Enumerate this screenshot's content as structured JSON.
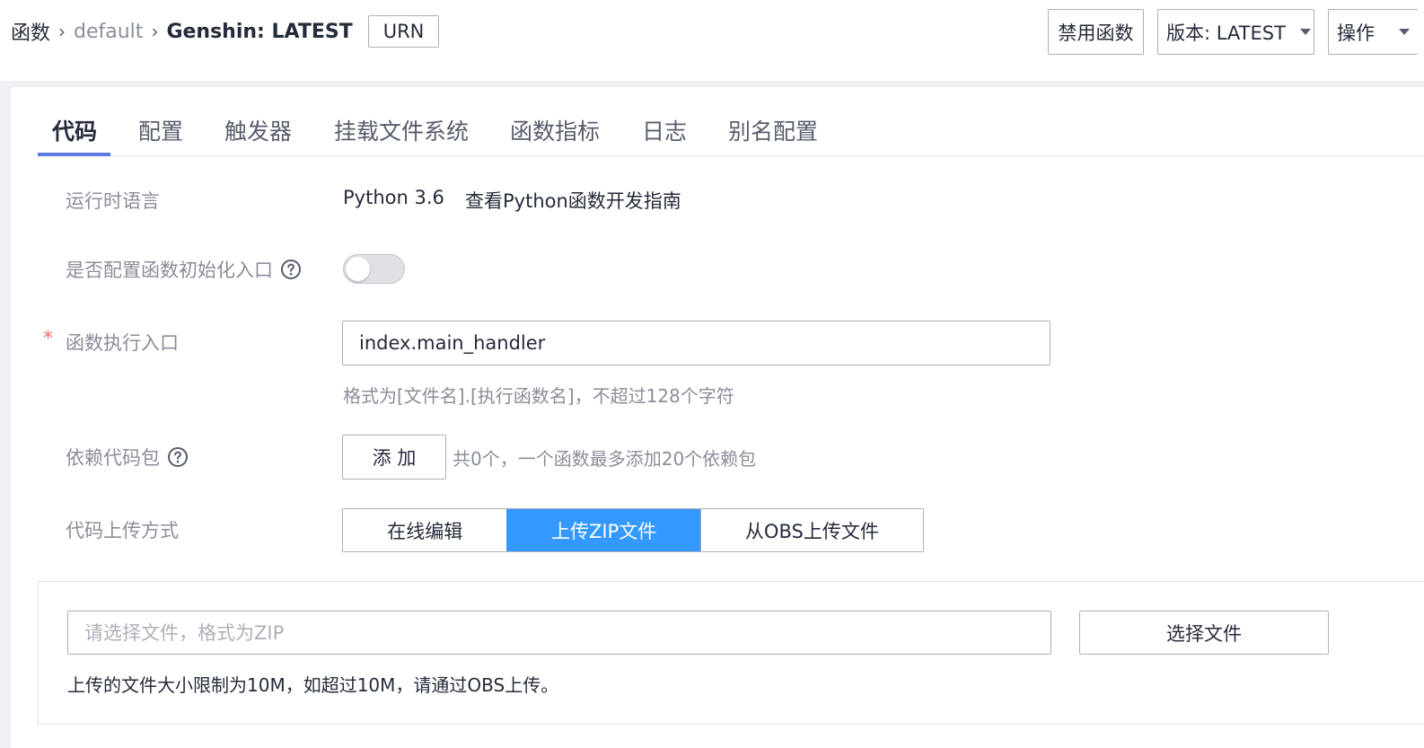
{
  "header": {
    "breadcrumb": {
      "root": "函数",
      "middle": "default",
      "current": "Genshin: LATEST"
    },
    "urn_label": "URN",
    "disable_button": "禁用函数",
    "version_select": "版本: LATEST",
    "actions_select": "操作"
  },
  "tabs": [
    {
      "label": "代码",
      "active": true
    },
    {
      "label": "配置"
    },
    {
      "label": "触发器"
    },
    {
      "label": "挂载文件系统"
    },
    {
      "label": "函数指标"
    },
    {
      "label": "日志"
    },
    {
      "label": "别名配置"
    }
  ],
  "form": {
    "runtime": {
      "label": "运行时语言",
      "value": "Python 3.6",
      "guide_link": "查看Python函数开发指南"
    },
    "init_entry": {
      "label": "是否配置函数初始化入口",
      "enabled": false
    },
    "handler": {
      "required_mark": "*",
      "label": "函数执行入口",
      "value": "index.main_handler",
      "hint": "格式为[文件名].[执行函数名]，不超过128个字符"
    },
    "dependencies": {
      "label": "依赖代码包",
      "add_button": "添 加",
      "info": "共0个，一个函数最多添加20个依赖包"
    },
    "upload_method": {
      "label": "代码上传方式",
      "options": [
        "在线编辑",
        "上传ZIP文件",
        "从OBS上传文件"
      ],
      "selected": "上传ZIP文件"
    },
    "upload": {
      "placeholder": "请选择文件，格式为ZIP",
      "choose_button": "选择文件",
      "note": "上传的文件大小限制为10M，如超过10M，请通过OBS上传。"
    }
  },
  "colors": {
    "accent": "#3399ff",
    "tab_ink": "#5e7ce0",
    "required": "#f66f6a"
  }
}
